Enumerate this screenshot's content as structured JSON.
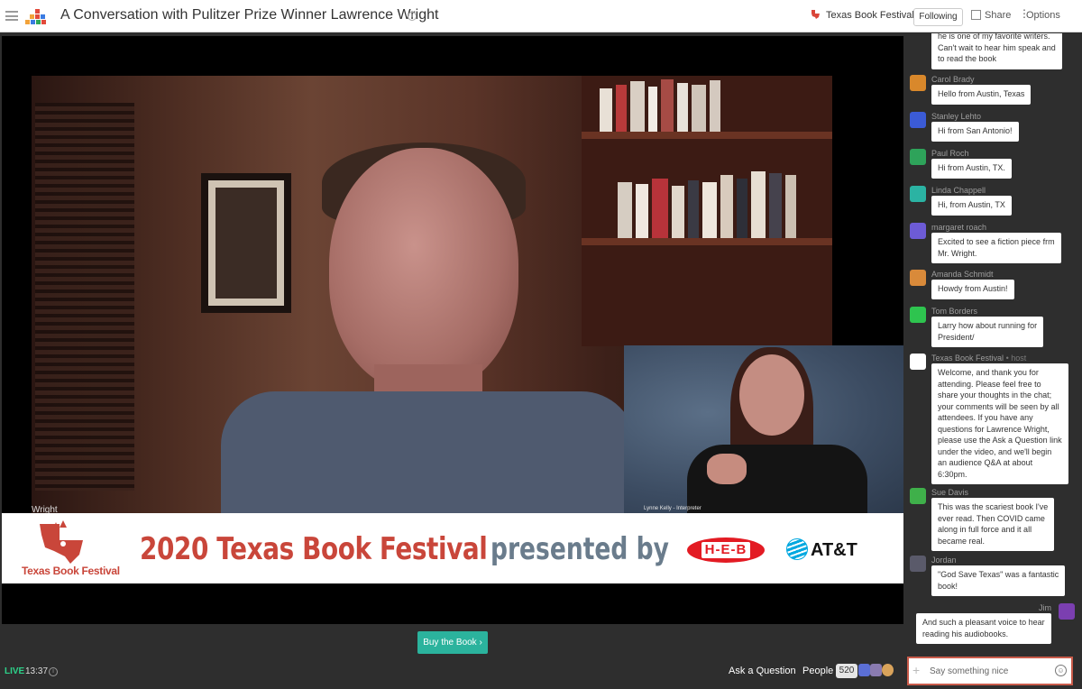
{
  "header": {
    "title": "A Conversation with Pulitzer Prize Winner Lawrence Wright",
    "org_name": "Texas Book Festival",
    "following_label": "Following",
    "share_label": "Share",
    "options_label": "Options"
  },
  "video": {
    "speaker_name_tag": "Wright",
    "interpreter_caption": "Lynne Kelly - Interpreter",
    "banner": {
      "logo_name": "Texas Book Festival",
      "title": "2020 Texas Book Festival",
      "presented_by": "presented by",
      "sponsor1": "H-E-B",
      "sponsor2": "AT&T"
    }
  },
  "buy_button": {
    "label": "Buy the Book ›"
  },
  "bottom_bar": {
    "live_label": "LIVE",
    "clock": "13:37",
    "ask_label": "Ask a Question",
    "people_label": "People",
    "people_count": "520"
  },
  "chat": {
    "messages": [
      {
        "name": "",
        "text_lines": [
          "he is one of my favorite writers.",
          "Can't wait to hear him speak and",
          "to read the book"
        ],
        "avatar_color": "#8a4fb5"
      },
      {
        "name": "Carol Brady",
        "text_lines": [
          "Hello from Austin, Texas"
        ],
        "avatar_color": "#d9882b"
      },
      {
        "name": "Stanley Lehto",
        "text_lines": [
          "Hi from San Antonio!"
        ],
        "avatar_color": "#3b5bd6"
      },
      {
        "name": "Paul Roch",
        "text_lines": [
          "Hi from Austin, TX."
        ],
        "avatar_color": "#2ea35a"
      },
      {
        "name": "Linda Chappell",
        "text_lines": [
          "Hi, from Austin, TX"
        ],
        "avatar_color": "#2bb3a3"
      },
      {
        "name": "margaret roach",
        "text_lines": [
          "Excited to see a fiction piece frm",
          "Mr. Wright."
        ],
        "avatar_color": "#6d5bd6"
      },
      {
        "name": "Amanda Schmidt",
        "text_lines": [
          "Howdy from Austin!"
        ],
        "avatar_color": "#d98a3a"
      },
      {
        "name": "Tom Borders",
        "text_lines": [
          "Larry how about running for",
          "President/"
        ],
        "avatar_color": "#2ec44f"
      },
      {
        "name": "Texas Book Festival",
        "role": "• host",
        "text_lines": [
          "Welcome, and thank you for",
          "attending. Please feel free to",
          "share your thoughts in the chat;",
          "your comments will be seen by all",
          "attendees. If you have any",
          "questions for Lawrence Wright,",
          "please use the Ask a Question link",
          "under the video, and we'll begin",
          "an audience Q&A at about",
          "6:30pm."
        ],
        "avatar_color": "#ffffff"
      },
      {
        "name": "Sue Davis",
        "text_lines": [
          "This was the scariest book I've",
          "ever read. Then COVID came",
          "along in full force and it all",
          "became real."
        ],
        "avatar_color": "#3fb04a"
      },
      {
        "name": "Jordan",
        "text_lines": [
          "\"God Save Texas\" was a fantastic",
          "book!"
        ],
        "avatar_color": "#5a5a6a"
      },
      {
        "name": "Jim",
        "text_lines": [
          "And such a pleasant voice to hear",
          "reading his audiobooks."
        ],
        "avatar_color": "#7b3fb0"
      }
    ],
    "input_placeholder": "Say something nice"
  },
  "colors": {
    "accent": "#2bb39d",
    "live": "#2dd28a",
    "brand_red": "#c9463a",
    "input_border": "#c95b4a"
  }
}
